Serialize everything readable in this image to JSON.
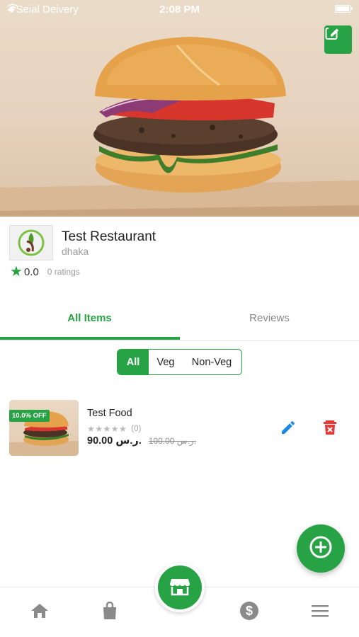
{
  "status_bar": {
    "carrier": "Seial Deivery",
    "time": "2:08 PM"
  },
  "hero": {
    "image": "burger-cover-photo",
    "edit_icon": "edit-square-icon"
  },
  "restaurant": {
    "name": "Test Restaurant",
    "city": "dhaka",
    "rating": "0.0",
    "ratings_count": "0 ratings"
  },
  "tabs": [
    {
      "label": "All Items",
      "active": true
    },
    {
      "label": "Reviews",
      "active": false
    }
  ],
  "filter": {
    "options": [
      "All",
      "Veg",
      "Non-Veg"
    ],
    "selected": "All"
  },
  "food_items": [
    {
      "name": "Test Food",
      "discount": "10.0% OFF",
      "stars": "★★★★★",
      "review_count": "(0)",
      "price": "90.00 ر.س.",
      "old_price": "100.00 ر.س."
    }
  ],
  "colors": {
    "primary": "#27a244",
    "delete": "#e53935",
    "edit": "#1e88e5",
    "muted": "#9a9a9a"
  },
  "bottom_nav": {
    "items": [
      "home-icon",
      "shopping-bag-icon",
      "store-icon",
      "dollar-icon",
      "menu-icon"
    ]
  },
  "fab": {
    "icon": "plus-circle-icon"
  }
}
